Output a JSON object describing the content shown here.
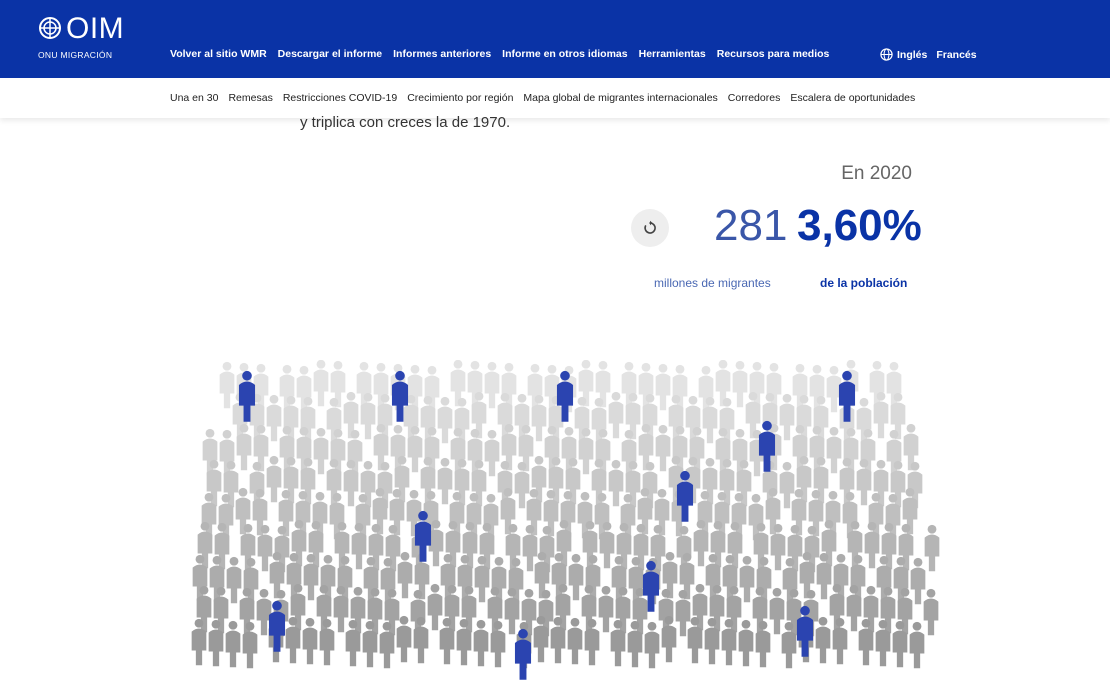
{
  "header": {
    "logo": "OIM",
    "logo_subtitle": "ONU MIGRACIÓN",
    "nav": [
      {
        "label": "Volver al sitio WMR"
      },
      {
        "label": "Descargar el informe"
      },
      {
        "label": "Informes anteriores"
      },
      {
        "label": "Informe en otros idiomas"
      },
      {
        "label": "Herramientas"
      },
      {
        "label": "Recursos para medios"
      }
    ],
    "languages": [
      {
        "label": "Inglés"
      },
      {
        "label": "Francés"
      }
    ]
  },
  "subnav": [
    {
      "label": "Una en 30"
    },
    {
      "label": "Remesas"
    },
    {
      "label": "Restricciones COVID-19"
    },
    {
      "label": "Crecimiento por región"
    },
    {
      "label": "Mapa global de migrantes internacionales"
    },
    {
      "label": "Corredores"
    },
    {
      "label": "Escalera de oportunidades"
    }
  ],
  "content": {
    "truncated_text": "y triplica con creces la de 1970.",
    "year_label": "En 2020",
    "migrants_value": "281",
    "migrants_label": "millones de migrantes",
    "population_pct": "3,60%",
    "population_label": "de la población"
  },
  "colors": {
    "brand_blue": "#0a33a6",
    "highlight_figure": "#2b44b0",
    "crowd_light": "#e3e3e3",
    "crowd_dark": "#9a9a9a"
  }
}
